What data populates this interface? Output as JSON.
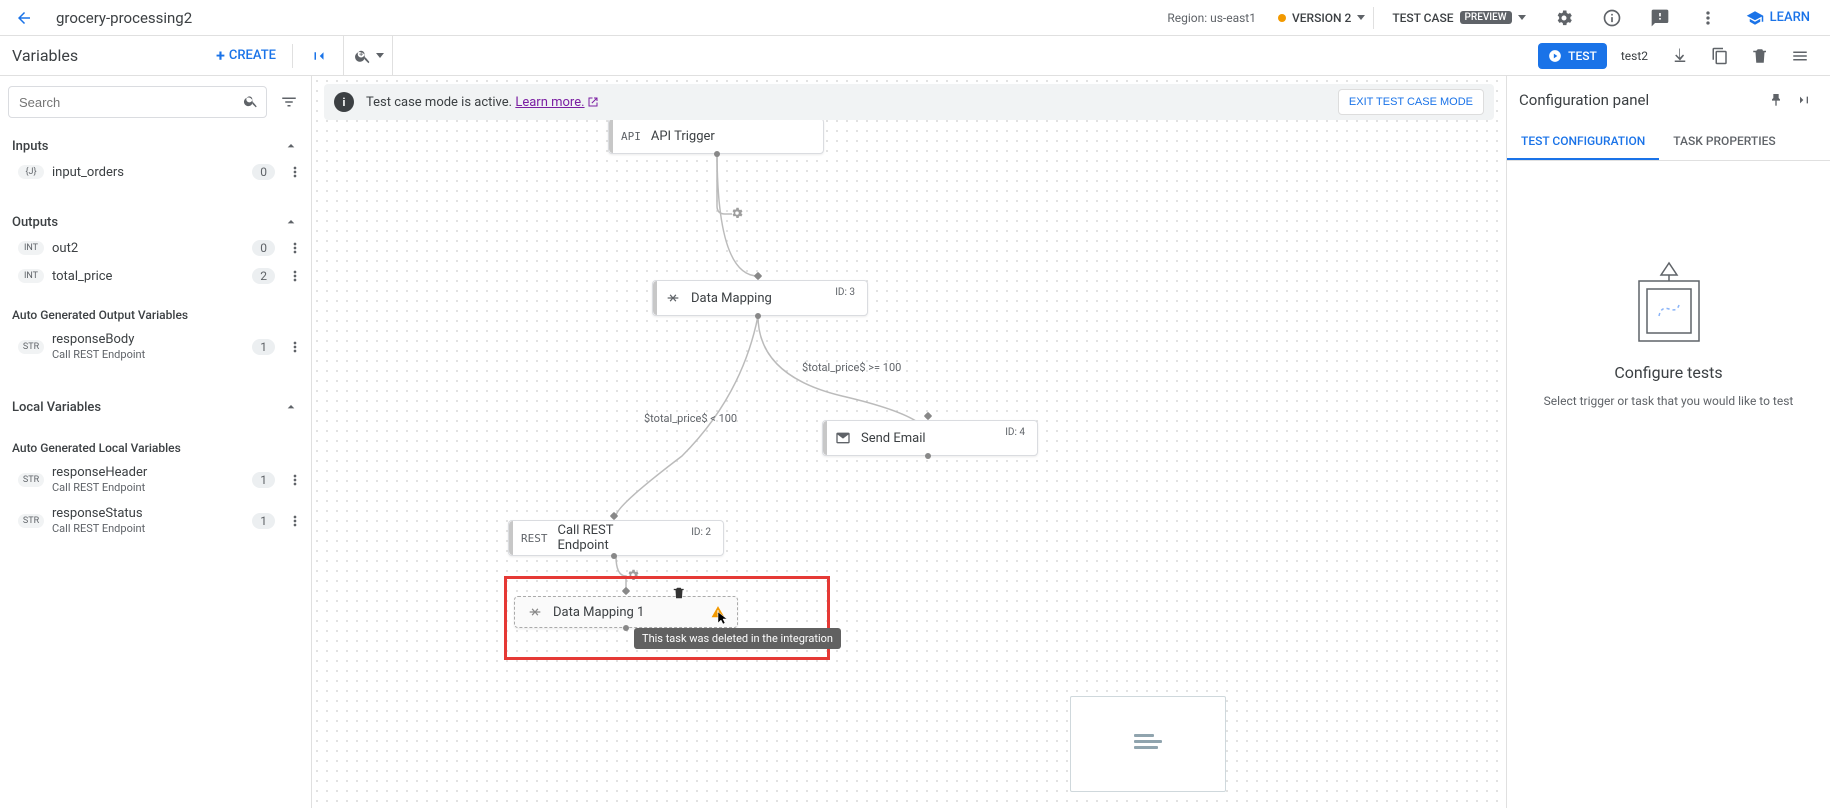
{
  "header": {
    "title": "grocery-processing2",
    "region": "Region: us-east1",
    "version": "VERSION 2",
    "testcase_label": "TEST CASE",
    "preview_badge": "PREVIEW",
    "learn": "LEARN"
  },
  "toolbar": {
    "variables_title": "Variables",
    "create": "CREATE",
    "test": "TEST",
    "test2": "test2"
  },
  "sidebar": {
    "search_placeholder": "Search",
    "sections": {
      "inputs": {
        "title": "Inputs",
        "items": [
          {
            "type": "{J}",
            "name": "input_orders",
            "count": "0"
          }
        ]
      },
      "outputs": {
        "title": "Outputs",
        "items": [
          {
            "type": "INT",
            "name": "out2",
            "count": "0"
          },
          {
            "type": "INT",
            "name": "total_price",
            "count": "2"
          }
        ]
      },
      "auto_out": {
        "title": "Auto Generated Output Variables",
        "items": [
          {
            "type": "STR",
            "name": "responseBody",
            "sub": "Call REST Endpoint",
            "count": "1"
          }
        ]
      },
      "local": {
        "title": "Local Variables"
      },
      "auto_local": {
        "title": "Auto Generated Local Variables",
        "items": [
          {
            "type": "STR",
            "name": "responseHeader",
            "sub": "Call REST Endpoint",
            "count": "1"
          },
          {
            "type": "STR",
            "name": "responseStatus",
            "sub": "Call REST Endpoint",
            "count": "1"
          }
        ]
      }
    }
  },
  "banner": {
    "text": "Test case mode is active.",
    "link": "Learn more.",
    "exit": "EXIT TEST CASE MODE"
  },
  "nodes": {
    "api_trigger": {
      "label": "API Trigger",
      "icon": "API"
    },
    "data_mapping": {
      "label": "Data Mapping",
      "id": "ID: 3"
    },
    "send_email": {
      "label": "Send Email",
      "id": "ID: 4"
    },
    "call_rest": {
      "label": "Call REST Endpoint",
      "id": "ID: 2",
      "icon": "REST"
    },
    "data_mapping1": {
      "label": "Data Mapping 1"
    }
  },
  "edges": {
    "ge100": "$total_price$ >= 100",
    "lt100": "$total_price$ < 100"
  },
  "tooltip": "This task was deleted in the integration",
  "right": {
    "title": "Configuration panel",
    "tab1": "TEST CONFIGURATION",
    "tab2": "TASK PROPERTIES",
    "cfg_title": "Configure tests",
    "cfg_sub": "Select trigger or task that you would like to test"
  }
}
